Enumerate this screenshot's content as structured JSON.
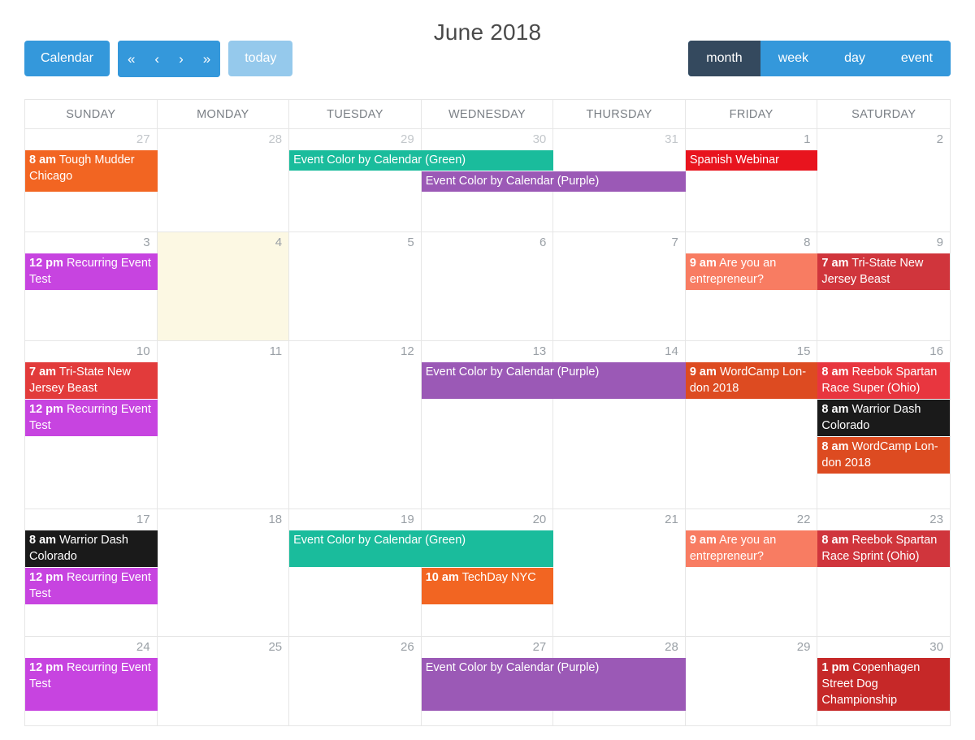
{
  "toolbar": {
    "calendar_label": "Calendar",
    "nav": {
      "prev_year": "«",
      "prev": "‹",
      "next": "›",
      "next_year": "»"
    },
    "today_label": "today",
    "views": [
      {
        "label": "month",
        "active": true
      },
      {
        "label": "week",
        "active": false
      },
      {
        "label": "day",
        "active": false
      },
      {
        "label": "event",
        "active": false
      }
    ]
  },
  "title": "June 2018",
  "colors": {
    "primary_blue": "#3498db",
    "today_blue": "#95c9ec",
    "active_view": "#34495e",
    "today_cell": "#fcf8e3",
    "grid_line": "#e6e6e6",
    "orange": "#f26522",
    "green": "#1abc9c",
    "purple": "#9b59b6",
    "magenta": "#c744e0",
    "bright_red": "#e8141e",
    "crimson": "#d0353c",
    "red": "#e23b3b",
    "salmon": "#f87c62",
    "dark_orange": "#dd4b21",
    "black": "#1a1a1a"
  },
  "day_headers": [
    "SUNDAY",
    "MONDAY",
    "TUESDAY",
    "WEDNESDAY",
    "THURSDAY",
    "FRIDAY",
    "SATURDAY"
  ],
  "weeks": [
    {
      "days": [
        {
          "num": "27",
          "other": true,
          "today": false
        },
        {
          "num": "28",
          "other": true,
          "today": false
        },
        {
          "num": "29",
          "other": true,
          "today": false
        },
        {
          "num": "30",
          "other": true,
          "today": false
        },
        {
          "num": "31",
          "other": true,
          "today": false
        },
        {
          "num": "1",
          "other": false,
          "today": false
        },
        {
          "num": "2",
          "other": false,
          "today": false
        }
      ],
      "rows": [
        [
          {
            "col": 1,
            "span": 1,
            "time": "8 am",
            "title": "Tough Mudder Chicago",
            "color": "#f26522",
            "rowspan": 2
          },
          {
            "col": 3,
            "span": 2,
            "time": "",
            "title": "Event Color by Calendar (Green)",
            "color": "#1abc9c"
          },
          {
            "col": 6,
            "span": 1,
            "time": "",
            "title": "Spanish Webinar",
            "color": "#e8141e"
          }
        ],
        [
          {
            "col": 4,
            "span": 2,
            "time": "",
            "title": "Event Color by Calendar (Purple)",
            "color": "#9b59b6"
          }
        ]
      ]
    },
    {
      "days": [
        {
          "num": "3",
          "other": false,
          "today": false
        },
        {
          "num": "4",
          "other": false,
          "today": true
        },
        {
          "num": "5",
          "other": false,
          "today": false
        },
        {
          "num": "6",
          "other": false,
          "today": false
        },
        {
          "num": "7",
          "other": false,
          "today": false
        },
        {
          "num": "8",
          "other": false,
          "today": false
        },
        {
          "num": "9",
          "other": false,
          "today": false
        }
      ],
      "rows": [
        [
          {
            "col": 1,
            "span": 1,
            "time": "12 pm",
            "title": "Recurring Event Test",
            "color": "#c744e0"
          },
          {
            "col": 6,
            "span": 1,
            "time": "9 am",
            "title": "Are you an entrepreneur?",
            "color": "#f87c62"
          },
          {
            "col": 7,
            "span": 1,
            "time": "7 am",
            "title": "Tri-State New Jersey Beast",
            "color": "#d0353c"
          }
        ]
      ]
    },
    {
      "days": [
        {
          "num": "10",
          "other": false,
          "today": false
        },
        {
          "num": "11",
          "other": false,
          "today": false
        },
        {
          "num": "12",
          "other": false,
          "today": false
        },
        {
          "num": "13",
          "other": false,
          "today": false
        },
        {
          "num": "14",
          "other": false,
          "today": false
        },
        {
          "num": "15",
          "other": false,
          "today": false
        },
        {
          "num": "16",
          "other": false,
          "today": false
        }
      ],
      "rows": [
        [
          {
            "col": 1,
            "span": 1,
            "time": "7 am",
            "title": "Tri-State New Jersey Beast",
            "color": "#e23b3b"
          },
          {
            "col": 4,
            "span": 2,
            "time": "",
            "title": "Event Color by Calendar (Purple)",
            "color": "#9b59b6"
          },
          {
            "col": 6,
            "span": 1,
            "time": "9 am",
            "title": "WordCamp Lon­don 2018",
            "color": "#dd4b21"
          },
          {
            "col": 7,
            "span": 1,
            "time": "8 am",
            "title": "Reebok Spartan Race Super (Ohio)",
            "color": "#e8363f"
          }
        ],
        [
          {
            "col": 1,
            "span": 1,
            "time": "12 pm",
            "title": "Recurring Event Test",
            "color": "#c744e0"
          },
          {
            "col": 7,
            "span": 1,
            "time": "8 am",
            "title": "Warrior Dash Colorado",
            "color": "#1a1a1a"
          }
        ],
        [
          {
            "col": 7,
            "span": 1,
            "time": "8 am",
            "title": "WordCamp Lon­don 2018",
            "color": "#dd4b21"
          }
        ]
      ]
    },
    {
      "days": [
        {
          "num": "17",
          "other": false,
          "today": false
        },
        {
          "num": "18",
          "other": false,
          "today": false
        },
        {
          "num": "19",
          "other": false,
          "today": false
        },
        {
          "num": "20",
          "other": false,
          "today": false
        },
        {
          "num": "21",
          "other": false,
          "today": false
        },
        {
          "num": "22",
          "other": false,
          "today": false
        },
        {
          "num": "23",
          "other": false,
          "today": false
        }
      ],
      "rows": [
        [
          {
            "col": 1,
            "span": 1,
            "time": "8 am",
            "title": "Warrior Dash Colorado",
            "color": "#1a1a1a"
          },
          {
            "col": 3,
            "span": 2,
            "time": "",
            "title": "Event Color by Calendar (Green)",
            "color": "#1abc9c"
          },
          {
            "col": 6,
            "span": 1,
            "time": "9 am",
            "title": "Are you an entrepreneur?",
            "color": "#f87c62"
          },
          {
            "col": 7,
            "span": 1,
            "time": "8 am",
            "title": "Reebok Spartan Race Sprint (Ohio)",
            "color": "#d0353c"
          }
        ],
        [
          {
            "col": 1,
            "span": 1,
            "time": "12 pm",
            "title": "Recurring Event Test",
            "color": "#c744e0"
          },
          {
            "col": 4,
            "span": 1,
            "time": "10 am",
            "title": "TechDay NYC",
            "color": "#f26522"
          }
        ]
      ]
    },
    {
      "days": [
        {
          "num": "24",
          "other": false,
          "today": false
        },
        {
          "num": "25",
          "other": false,
          "today": false
        },
        {
          "num": "26",
          "other": false,
          "today": false
        },
        {
          "num": "27",
          "other": false,
          "today": false
        },
        {
          "num": "28",
          "other": false,
          "today": false
        },
        {
          "num": "29",
          "other": false,
          "today": false
        },
        {
          "num": "30",
          "other": false,
          "today": false
        }
      ],
      "rows": [
        [
          {
            "col": 1,
            "span": 1,
            "time": "12 pm",
            "title": "Recurring Event Test",
            "color": "#c744e0"
          },
          {
            "col": 4,
            "span": 2,
            "time": "",
            "title": "Event Color by Calendar (Purple)",
            "color": "#9b59b6"
          },
          {
            "col": 7,
            "span": 1,
            "time": "1 pm",
            "title": "Copenhagen Street Dog Championship",
            "color": "#c62828"
          }
        ]
      ]
    }
  ]
}
